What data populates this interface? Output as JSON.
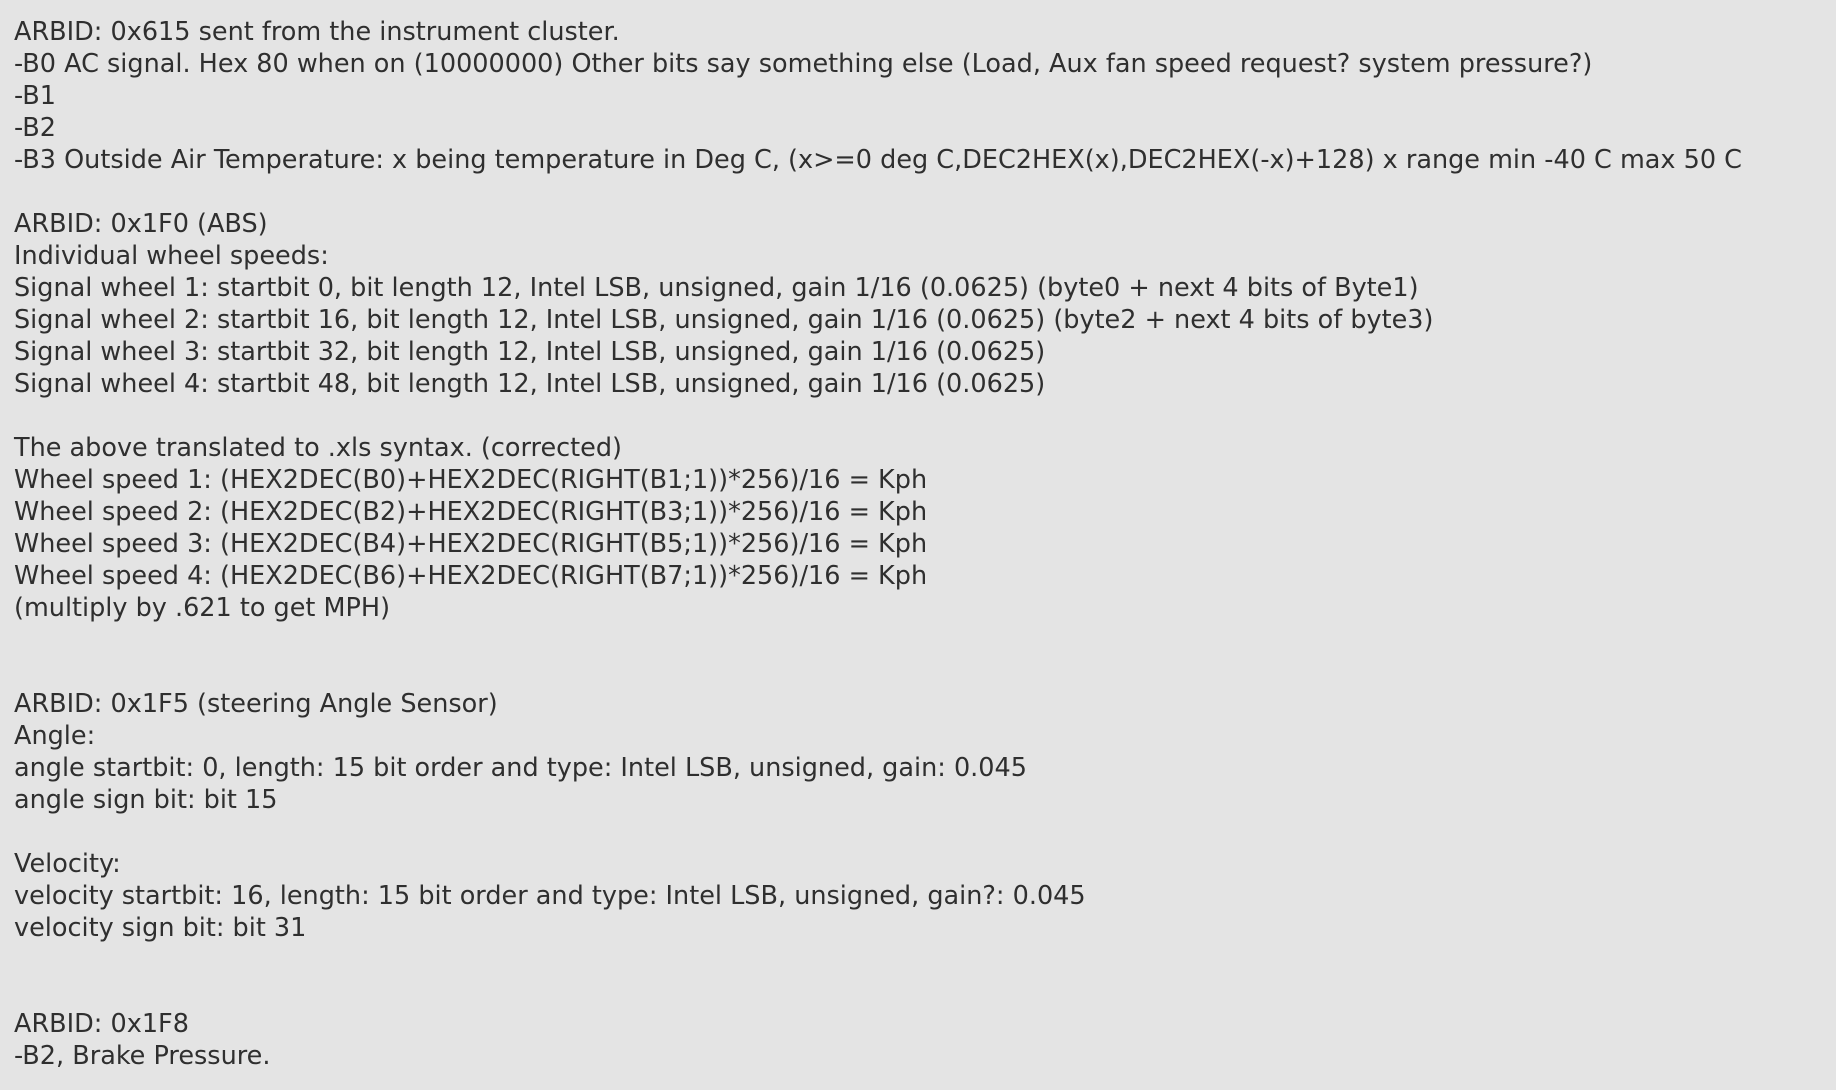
{
  "document": {
    "lines": [
      "ARBID: 0x615 sent from the instrument cluster.",
      "-B0 AC signal. Hex 80 when on (10000000) Other bits say something else (Load, Aux fan speed request? system pressure?)",
      "-B1",
      "-B2",
      "-B3 Outside Air Temperature: x being temperature in Deg C, (x>=0 deg C,DEC2HEX(x),DEC2HEX(-x)+128) x range min -40 C max 50 C",
      "",
      "ARBID: 0x1F0 (ABS)",
      "Individual wheel speeds:",
      "Signal wheel 1: startbit 0, bit length 12, Intel LSB, unsigned, gain 1/16 (0.0625) (byte0 + next 4 bits of Byte1)",
      "Signal wheel 2: startbit 16, bit length 12, Intel LSB, unsigned, gain 1/16 (0.0625) (byte2 + next 4 bits of byte3)",
      "Signal wheel 3: startbit 32, bit length 12, Intel LSB, unsigned, gain 1/16 (0.0625)",
      "Signal wheel 4: startbit 48, bit length 12, Intel LSB, unsigned, gain 1/16 (0.0625)",
      "",
      "The above translated to .xls syntax. (corrected)",
      "Wheel speed 1: (HEX2DEC(B0)+HEX2DEC(RIGHT(B1;1))*256)/16 = Kph",
      "Wheel speed 2: (HEX2DEC(B2)+HEX2DEC(RIGHT(B3;1))*256)/16 = Kph",
      "Wheel speed 3: (HEX2DEC(B4)+HEX2DEC(RIGHT(B5;1))*256)/16 = Kph",
      "Wheel speed 4: (HEX2DEC(B6)+HEX2DEC(RIGHT(B7;1))*256)/16 = Kph",
      "(multiply by .621 to get MPH)",
      "",
      "",
      "ARBID: 0x1F5 (steering Angle Sensor)",
      "Angle:",
      "angle startbit: 0, length: 15 bit order and type: Intel LSB, unsigned, gain: 0.045",
      "angle sign bit: bit 15",
      "",
      "Velocity:",
      "velocity startbit: 16, length: 15 bit order and type: Intel LSB, unsigned, gain?: 0.045",
      "velocity sign bit: bit 31",
      "",
      "",
      "ARBID: 0x1F8",
      "-B2, Brake Pressure."
    ]
  }
}
